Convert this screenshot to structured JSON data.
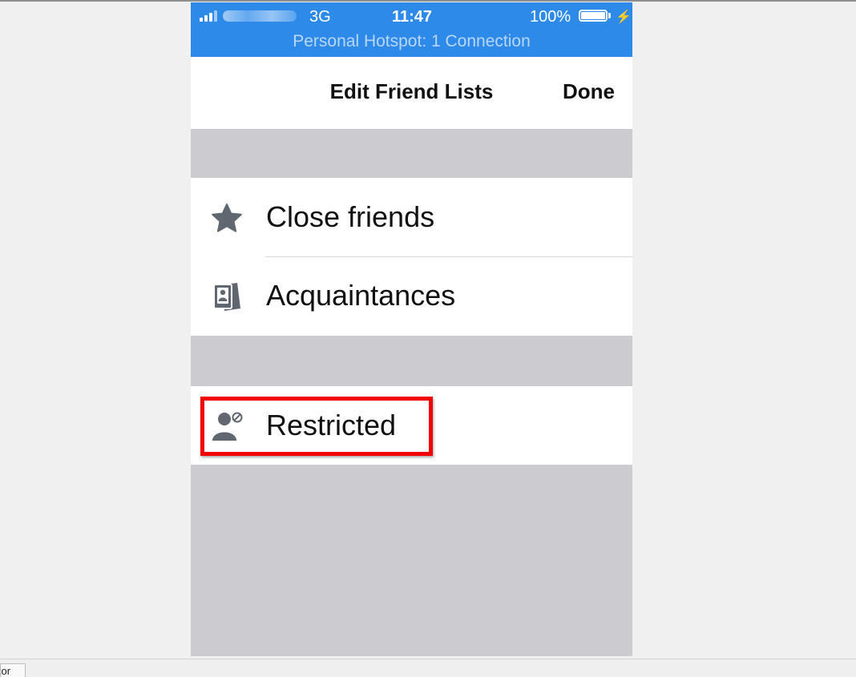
{
  "status_bar": {
    "network": "3G",
    "time": "11:47",
    "battery": "100%",
    "hotspot": "Personal Hotspot: 1 Connection",
    "icons": [
      "signal-icon",
      "battery-icon",
      "charging-bolt-icon"
    ]
  },
  "nav": {
    "title": "Edit Friend Lists",
    "done": "Done"
  },
  "lists": {
    "close_friends": {
      "label": "Close friends",
      "icon": "star-icon"
    },
    "acquaintances": {
      "label": "Acquaintances",
      "icon": "id-card-person-icon"
    },
    "restricted": {
      "label": "Restricted",
      "icon": "person-restricted-icon"
    }
  },
  "colors": {
    "status_bar": "#2e8ae9",
    "icon_gray": "#606770",
    "group_background": "#cbcbd0",
    "highlight": "#f20000"
  },
  "bottom_tab": {
    "label": "itor"
  }
}
